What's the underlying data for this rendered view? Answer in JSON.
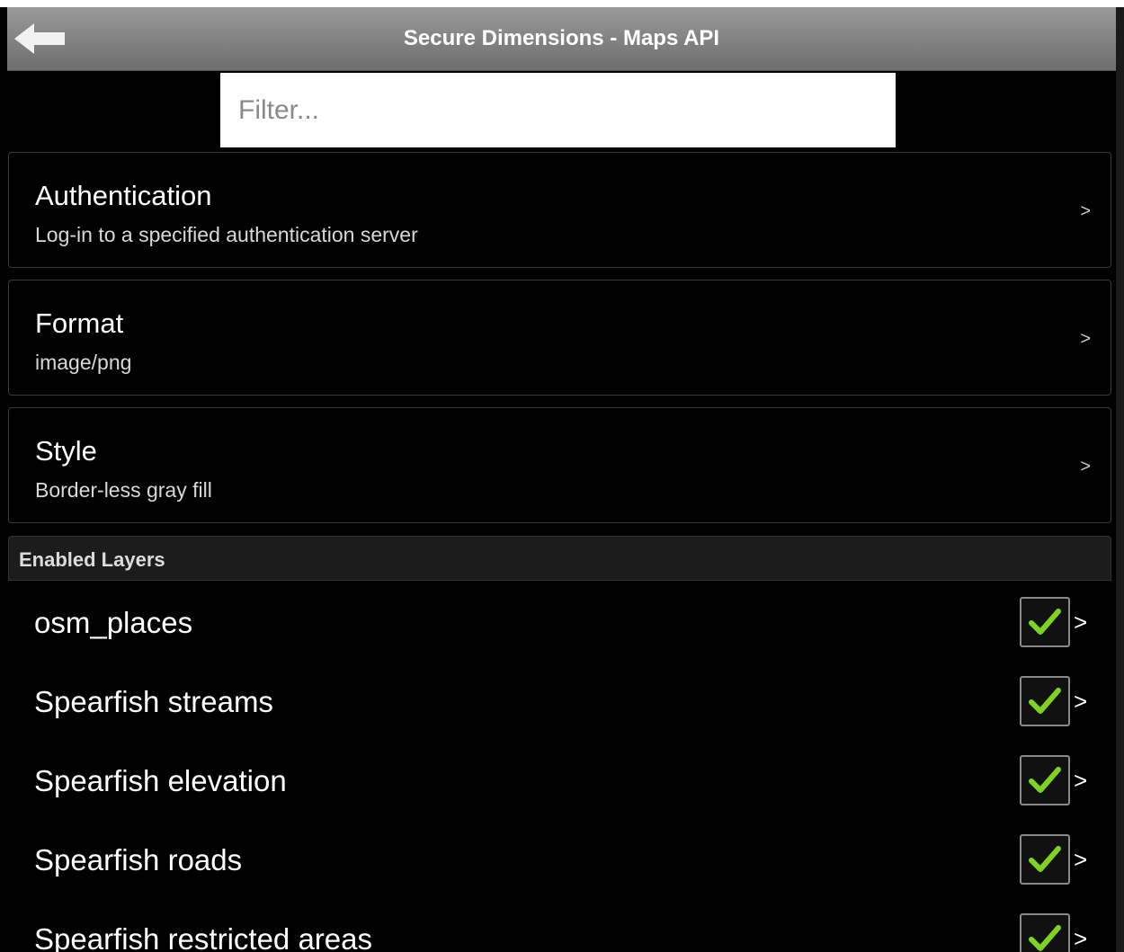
{
  "header": {
    "title": "Secure Dimensions - Maps API",
    "back_icon": "back-arrow-icon"
  },
  "filter": {
    "placeholder": "Filter...",
    "value": ""
  },
  "settings": [
    {
      "title": "Authentication",
      "subtitle": "Log-in to a specified authentication server",
      "chevron": ">"
    },
    {
      "title": "Format",
      "subtitle": "image/png",
      "chevron": ">"
    },
    {
      "title": "Style",
      "subtitle": "Border-less gray fill",
      "chevron": ">"
    }
  ],
  "layers_section": {
    "title": "Enabled Layers",
    "items": [
      {
        "label": "osm_places",
        "checked": true,
        "chevron": ">"
      },
      {
        "label": "Spearfish streams",
        "checked": true,
        "chevron": ">"
      },
      {
        "label": "Spearfish elevation",
        "checked": true,
        "chevron": ">"
      },
      {
        "label": "Spearfish roads",
        "checked": true,
        "chevron": ">"
      },
      {
        "label": "Spearfish restricted areas",
        "checked": true,
        "chevron": ">"
      }
    ]
  },
  "colors": {
    "background": "#000000",
    "header_bar": "#8a8a8a",
    "check_green": "#7ed321"
  }
}
